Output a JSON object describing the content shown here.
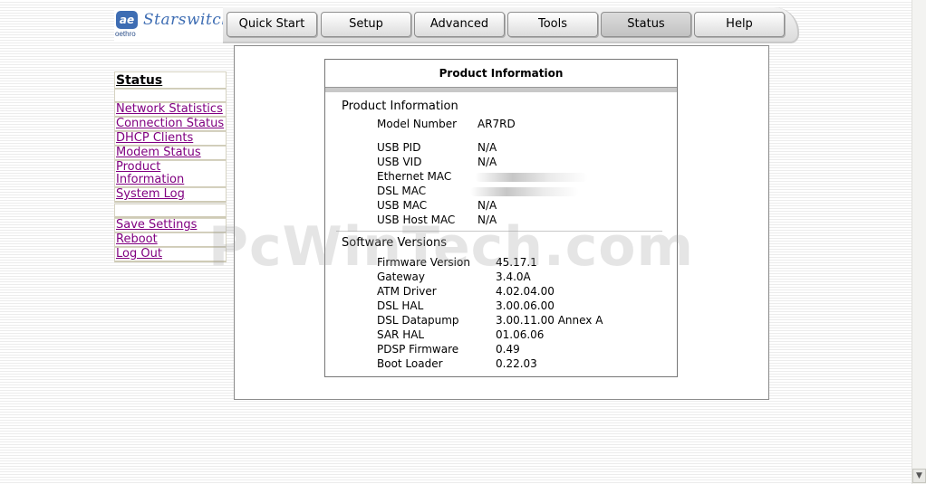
{
  "brand": {
    "logo_mark": "ae",
    "logo_sub": "oethro",
    "logo_word": "Starswitch"
  },
  "nav": {
    "tabs": [
      "Quick Start",
      "Setup",
      "Advanced",
      "Tools",
      "Status",
      "Help"
    ],
    "active": "Status"
  },
  "sidebar": {
    "title": "Status",
    "links": [
      "Network Statistics",
      "Connection Status",
      "DHCP Clients",
      "Modem Status",
      "Product Information",
      "System Log"
    ],
    "actions": [
      "Save Settings",
      "Reboot",
      "Log Out"
    ]
  },
  "panel": {
    "title": "Product Information",
    "product_section": "Product Information",
    "product": [
      {
        "label": "Model Number",
        "value": "AR7RD"
      },
      {
        "label": "USB PID",
        "value": "N/A"
      },
      {
        "label": "USB VID",
        "value": "N/A"
      },
      {
        "label": "Ethernet MAC",
        "value": ""
      },
      {
        "label": "DSL MAC",
        "value": ""
      },
      {
        "label": "USB MAC",
        "value": "N/A"
      },
      {
        "label": "USB Host MAC",
        "value": "N/A"
      }
    ],
    "software_section": "Software Versions",
    "software": [
      {
        "label": "Firmware Version",
        "value": "45.17.1"
      },
      {
        "label": "Gateway",
        "value": "3.4.0A"
      },
      {
        "label": "ATM Driver",
        "value": "4.02.04.00"
      },
      {
        "label": "DSL HAL",
        "value": "3.00.06.00"
      },
      {
        "label": "DSL Datapump",
        "value": "3.00.11.00 Annex A"
      },
      {
        "label": "SAR HAL",
        "value": "01.06.06"
      },
      {
        "label": "PDSP Firmware",
        "value": "0.49"
      },
      {
        "label": "Boot Loader",
        "value": "0.22.03"
      }
    ]
  },
  "watermark": "PcWinTech.com"
}
